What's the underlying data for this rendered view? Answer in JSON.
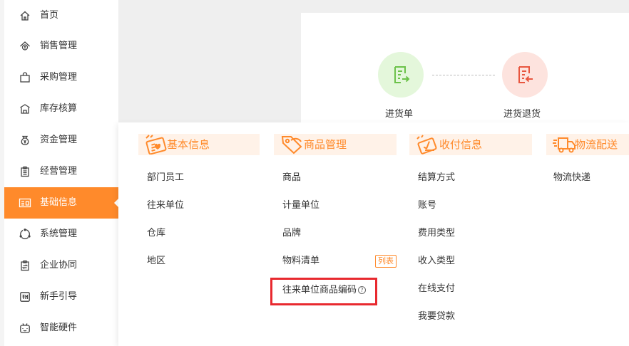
{
  "sidebar": {
    "items": [
      {
        "label": "首页",
        "icon": "home-icon"
      },
      {
        "label": "销售管理",
        "icon": "sales-icon"
      },
      {
        "label": "采购管理",
        "icon": "purchase-bag-icon"
      },
      {
        "label": "库存核算",
        "icon": "warehouse-icon"
      },
      {
        "label": "资金管理",
        "icon": "money-bag-icon"
      },
      {
        "label": "经营管理",
        "icon": "clipboard-icon"
      },
      {
        "label": "基础信息",
        "icon": "id-card-icon",
        "active": true
      },
      {
        "label": "系统管理",
        "icon": "system-icon"
      },
      {
        "label": "企业协同",
        "icon": "collaboration-icon"
      },
      {
        "label": "新手引导",
        "icon": "new-guide-icon"
      },
      {
        "label": "智能硬件",
        "icon": "smart-hardware-icon"
      }
    ]
  },
  "flow": {
    "purchase_in_label": "进货单",
    "purchase_return_label": "进货退货"
  },
  "mega_menu": {
    "columns": [
      {
        "title": "基本信息",
        "icon": "basic-info-icon",
        "links": [
          "部门员工",
          "往来单位",
          "仓库",
          "地区"
        ]
      },
      {
        "title": "商品管理",
        "icon": "product-tag-icon",
        "links": [
          "商品",
          "计量单位",
          "品牌",
          "物料清单",
          "往来单位商品编码"
        ],
        "badge": "列表"
      },
      {
        "title": "收付信息",
        "icon": "payment-icon",
        "links": [
          "结算方式",
          "账号",
          "费用类型",
          "收入类型",
          "在线支付",
          "我要贷款"
        ]
      },
      {
        "title": "物流配送",
        "icon": "truck-icon",
        "links": [
          "物流快递"
        ]
      }
    ]
  },
  "colors": {
    "accent": "#ff8a2b",
    "highlight": "#e8292f",
    "green_node": "#e4f7db",
    "red_node": "#fde3de"
  }
}
